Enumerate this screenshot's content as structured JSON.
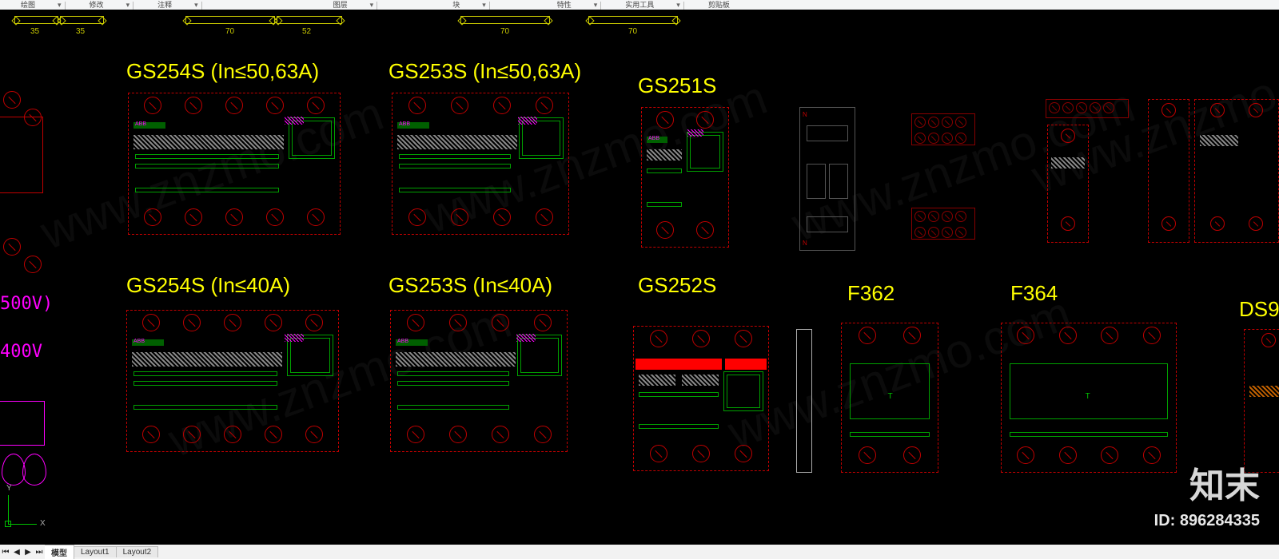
{
  "ribbon": {
    "groups": [
      "绘图",
      "修改",
      "注释",
      "图层",
      "块",
      "特性",
      "实用工具",
      "剪贴板"
    ],
    "dropdown_glyph": "▾"
  },
  "dimensions": {
    "d1": "35",
    "d2": "35",
    "d3": "70",
    "d4": "52",
    "d5": "70",
    "d6": "70"
  },
  "labels": {
    "row1_c1": "GS254S (In≤50,63A)",
    "row1_c2": "GS253S (In≤50,63A)",
    "row1_c3": "GS251S",
    "row2_c1": "GS254S (In≤40A)",
    "row2_c2": "GS253S (In≤40A)",
    "row2_c3": "GS252S",
    "row2_c4": "F362",
    "row2_c5": "F364",
    "row2_c6": "DS9"
  },
  "left_text": {
    "l1": "500V)",
    "l2": "400V"
  },
  "brand_tags": {
    "abb": "ABB",
    "n": "N",
    "t": "T"
  },
  "axis": {
    "x": "X",
    "y": "Y"
  },
  "tabs": {
    "t0": "模型",
    "t1": "Layout1",
    "t2": "Layout2"
  },
  "watermark": {
    "text": "www.znzmo.com",
    "brand": "知末",
    "id_label": "ID: 896284335"
  }
}
